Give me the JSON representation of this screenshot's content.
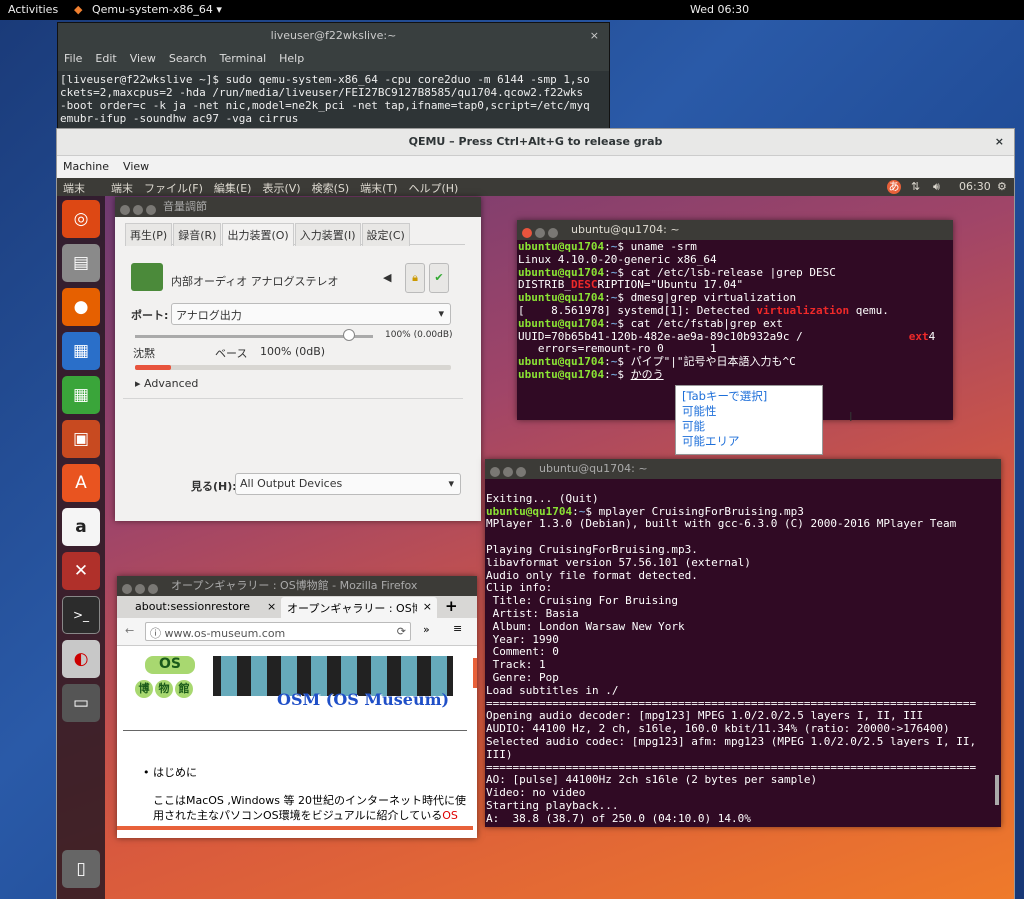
{
  "host": {
    "activities": "Activities",
    "app_name": "Qemu-system-x86_64 ▾",
    "clock": "Wed 06:30"
  },
  "host_terminal": {
    "title": "liveuser@f22wkslive:~",
    "menu": [
      "File",
      "Edit",
      "View",
      "Search",
      "Terminal",
      "Help"
    ],
    "lines": [
      "[liveuser@f22wkslive ~]$ sudo qemu-system-x86_64 -cpu core2duo -m 6144 -smp 1,so",
      "ckets=2,maxcpus=2 -hda /run/media/liveuser/FEI27BC9127B8585/qu1704.qcow2.f22wks",
      "-boot order=c -k ja -net nic,model=ne2k_pci -net tap,ifname=tap0,script=/etc/myq",
      "emubr-ifup -soundhw ac97 -vga cirrus"
    ]
  },
  "qemu": {
    "title": "QEMU – Press Ctrl+Alt+G to release grab",
    "menu": [
      "Machine",
      "View"
    ]
  },
  "guest_panel": {
    "app": "端末",
    "menu": [
      "端末",
      "ファイル(F)",
      "編集(E)",
      "表示(V)",
      "検索(S)",
      "端末(T)",
      "ヘルプ(H)"
    ],
    "ime": "あ",
    "clock": "06:30"
  },
  "sound": {
    "title": "音量調節",
    "tabs": [
      "再生(P)",
      "録音(R)",
      "出力装置(O)",
      "入力装置(I)",
      "設定(C)"
    ],
    "device": "内部オーディオ アナログステレオ",
    "port_label": "ポート:",
    "port_value": "アナログ出力",
    "volume_pct": "100% (0.00dB)",
    "silence": "沈黙",
    "base": "ベース",
    "base_pct": "100% (0dB)",
    "advanced": "Advanced",
    "show_label": "見る(H):",
    "show_value": "All Output Devices",
    "volume_level": 1.0
  },
  "term1": {
    "title": "ubuntu@qu1704: ~",
    "prompt": "ubuntu@qu1704",
    "lines": [
      {
        "p": true,
        "cmd": "uname -srm"
      },
      {
        "t": "Linux 4.10.0-20-generic x86_64"
      },
      {
        "p": true,
        "cmd": "cat /etc/lsb-release |grep DESC"
      },
      {
        "a": "DISTRIB_",
        "r": "DESC",
        "b": "RIPTION=\"Ubuntu 17.04\""
      },
      {
        "p": true,
        "cmd": "dmesg|grep virtualization"
      },
      {
        "a": "[    8.561978] systemd[1]: Detected ",
        "r": "virtualization",
        "b": " qemu."
      },
      {
        "p": true,
        "cmd": "cat /etc/fstab|grep ext"
      },
      {
        "a": "UUID=70b65b41-120b-482e-ae9a-89c10b932a9c /                ",
        "r": "ext",
        "b": "4"
      },
      {
        "t": "   errors=remount-ro 0       1"
      },
      {
        "p": true,
        "cmd": "パイプ\"|\"記号や日本語入力も^C"
      },
      {
        "p": true,
        "cmd": "かのう",
        "u": true
      }
    ]
  },
  "ime_candidates": [
    "[Tabキーで選択]",
    "可能性",
    "可能",
    "可能エリア"
  ],
  "term2": {
    "title": "ubuntu@qu1704: ~",
    "lines": [
      "",
      "Exiting... (Quit)",
      "§ubuntu@qu1704:~$ mplayer CruisingForBruising.mp3",
      "MPlayer 1.3.0 (Debian), built with gcc-6.3.0 (C) 2000-2016 MPlayer Team",
      "",
      "Playing CruisingForBruising.mp3.",
      "libavformat version 57.56.101 (external)",
      "Audio only file format detected.",
      "Clip info:",
      " Title: Cruising For Bruising",
      " Artist: Basia",
      " Album: London Warsaw New York",
      " Year: 1990",
      " Comment: 0",
      " Track: 1",
      " Genre: Pop",
      "Load subtitles in ./",
      "==========================================================================",
      "Opening audio decoder: [mpg123] MPEG 1.0/2.0/2.5 layers I, II, III",
      "AUDIO: 44100 Hz, 2 ch, s16le, 160.0 kbit/11.34% (ratio: 20000->176400)",
      "Selected audio codec: [mpg123] afm: mpg123 (MPEG 1.0/2.0/2.5 layers I, II,",
      "III)",
      "==========================================================================",
      "AO: [pulse] 44100Hz 2ch s16le (2 bytes per sample)",
      "Video: no video",
      "Starting playback...",
      "A:  38.8 (38.7) of 250.0 (04:10.0) 14.0%"
    ]
  },
  "firefox": {
    "title": "オープンギャラリー : OS博物館 - Mozilla Firefox",
    "tabs": [
      "about:sessionrestore",
      "オープンギャラリー : OS博物"
    ],
    "url": "www.os-museum.com",
    "logo_os": "OS",
    "logo_kanji": [
      "博",
      "物",
      "館"
    ],
    "banner": "OSM (OS Museum)",
    "bullet": "はじめに",
    "para1": "ここはMacOS ,Windows 等 20世紀のインターネット時代に使",
    "para2": "用された主なパソコンOS環境をビジュアルに紹介している",
    "para2_red": "OS"
  }
}
